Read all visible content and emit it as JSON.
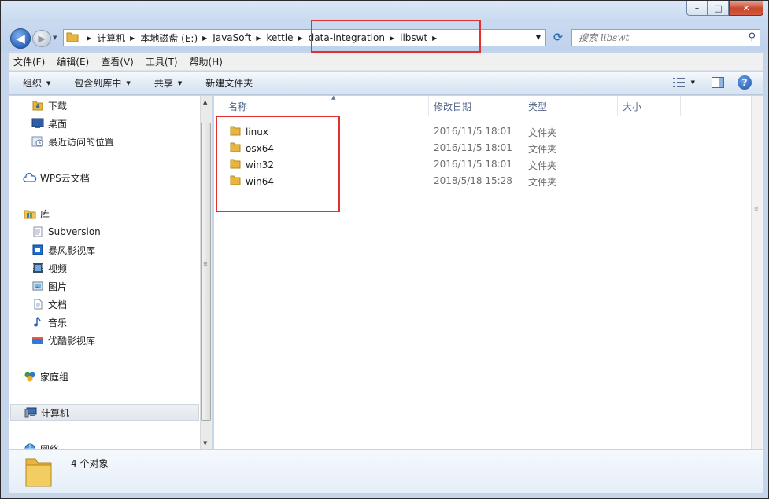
{
  "window": {
    "minimize_label": "–",
    "maximize_label": "□",
    "close_label": "✕"
  },
  "nav": {
    "back_glyph": "◀",
    "forward_glyph": "▶",
    "refresh_glyph": "⟳"
  },
  "address": {
    "crumbs": [
      "计算机",
      "本地磁盘 (E:)",
      "JavaSoft",
      "kettle",
      "data-integration",
      "libswt"
    ]
  },
  "search": {
    "placeholder": "搜索 libswt"
  },
  "menu": {
    "items": [
      "文件(F)",
      "编辑(E)",
      "查看(V)",
      "工具(T)",
      "帮助(H)"
    ]
  },
  "toolbar": {
    "organize": "组织",
    "include_in_library": "包含到库中",
    "share": "共享",
    "new_folder": "新建文件夹"
  },
  "sidebar": {
    "items": [
      {
        "label": "下载",
        "icon": "download-folder-icon"
      },
      {
        "label": "桌面",
        "icon": "desktop-icon"
      },
      {
        "label": "最近访问的位置",
        "icon": "recent-places-icon"
      },
      {
        "label": "WPS云文档",
        "icon": "cloud-icon"
      },
      {
        "label": "库",
        "icon": "library-icon"
      },
      {
        "label": "Subversion",
        "icon": "library-folder-icon"
      },
      {
        "label": "暴风影视库",
        "icon": "video-library-icon"
      },
      {
        "label": "视频",
        "icon": "video-icon"
      },
      {
        "label": "图片",
        "icon": "picture-icon"
      },
      {
        "label": "文档",
        "icon": "document-icon"
      },
      {
        "label": "音乐",
        "icon": "music-icon"
      },
      {
        "label": "优酷影视库",
        "icon": "youku-library-icon"
      },
      {
        "label": "家庭组",
        "icon": "homegroup-icon"
      },
      {
        "label": "计算机",
        "icon": "computer-icon"
      },
      {
        "label": "网络",
        "icon": "network-icon"
      }
    ]
  },
  "columns": {
    "name": "名称",
    "modified": "修改日期",
    "type": "类型",
    "size": "大小"
  },
  "files": [
    {
      "name": "linux",
      "modified": "2016/11/5 18:01",
      "type": "文件夹"
    },
    {
      "name": "osx64",
      "modified": "2016/11/5 18:01",
      "type": "文件夹"
    },
    {
      "name": "win32",
      "modified": "2016/11/5 18:01",
      "type": "文件夹"
    },
    {
      "name": "win64",
      "modified": "2018/5/18 15:28",
      "type": "文件夹"
    }
  ],
  "details": {
    "count": "4 个对象"
  },
  "colors": {
    "highlight": "#e03030",
    "folder": "#e8b640"
  }
}
